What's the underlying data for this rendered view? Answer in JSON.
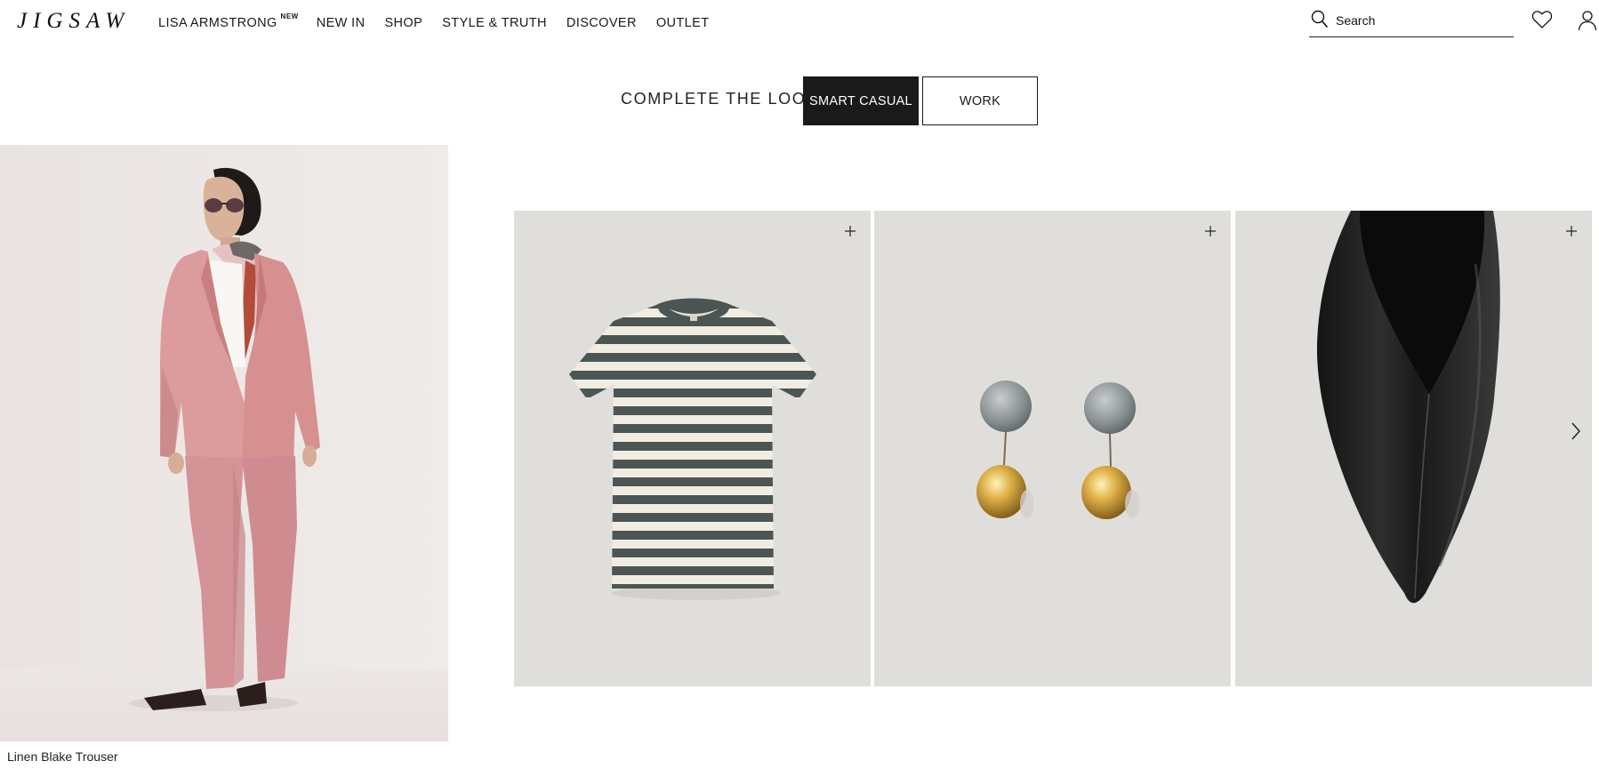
{
  "header": {
    "logo": "JIGSAW",
    "nav": [
      {
        "label": "LISA ARMSTRONG",
        "badge": "NEW"
      },
      {
        "label": "NEW IN"
      },
      {
        "label": "SHOP"
      },
      {
        "label": "STYLE & TRUTH"
      },
      {
        "label": "DISCOVER"
      },
      {
        "label": "OUTLET"
      }
    ],
    "search": {
      "placeholder": "Search",
      "icon": "search-icon"
    },
    "icons": {
      "wishlist": "heart-icon",
      "account": "user-icon"
    }
  },
  "complete_the_look": {
    "label": "COMPLETE THE LOOK",
    "tabs": [
      {
        "label": "SMART CASUAL",
        "active": true
      },
      {
        "label": "WORK",
        "active": false
      }
    ]
  },
  "model": {
    "caption": "Linen Blake Trouser"
  },
  "products": [
    {
      "item": "Striped t-shirt",
      "icon": "plus-icon"
    },
    {
      "item": "Ball earrings",
      "icon": "plus-icon"
    },
    {
      "item": "Black leather pointed flat",
      "icon": "plus-icon"
    }
  ],
  "carousel": {
    "next_icon": "chevron-right-icon"
  },
  "colors": {
    "text": "#1a1a1a",
    "active_tab_bg": "#1a1a1a",
    "card_bg": "#e0dedb",
    "stripe_dark": "#4b5654",
    "stripe_light": "#f1ece1",
    "suit_pink": "#d9969a"
  }
}
